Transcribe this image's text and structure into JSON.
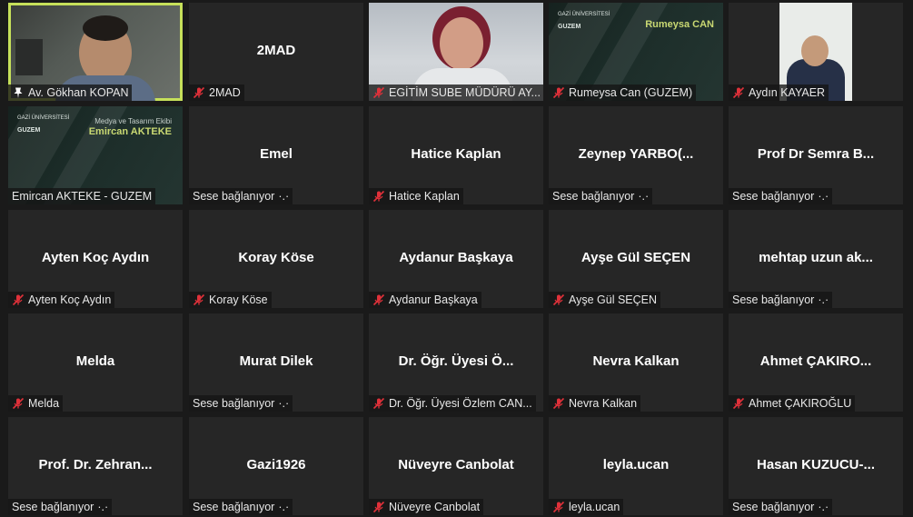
{
  "tiles": [
    {
      "id": "gokhan",
      "center": "",
      "label": "Av. Gökhan KOPAN",
      "icon": "pin",
      "connecting": false,
      "video": "gokhan",
      "active": true
    },
    {
      "id": "2mad",
      "center": "2MAD",
      "label": "2MAD",
      "icon": "mic-muted",
      "connecting": false
    },
    {
      "id": "egitim",
      "center": "",
      "label": "EGİTİM SUBE MÜDÜRÜ AY...",
      "icon": "mic-muted",
      "connecting": false,
      "video": "egitim"
    },
    {
      "id": "rumeysa",
      "center": "",
      "label": "Rumeysa Can (GUZEM)",
      "icon": "mic-muted",
      "connecting": false,
      "video": "rumeysa"
    },
    {
      "id": "aydin",
      "center": "",
      "label": "Aydın KAYAER",
      "icon": "mic-muted",
      "connecting": false,
      "video": "aydin"
    },
    {
      "id": "emircan",
      "center": "",
      "label": "Emircan AKTEKE - GUZEM",
      "icon": "none",
      "connecting": false,
      "video": "emircan"
    },
    {
      "id": "emel",
      "center": "Emel",
      "label": "Sese bağlanıyor",
      "icon": "none",
      "connecting": true
    },
    {
      "id": "hatice",
      "center": "Hatice Kaplan",
      "label": "Hatice Kaplan",
      "icon": "mic-muted",
      "connecting": false
    },
    {
      "id": "zeynep",
      "center": "Zeynep YARBO(...",
      "label": "Sese bağlanıyor",
      "icon": "none",
      "connecting": true
    },
    {
      "id": "semra",
      "center": "Prof Dr Semra B...",
      "label": "Sese bağlanıyor",
      "icon": "none",
      "connecting": true
    },
    {
      "id": "ayten",
      "center": "Ayten Koç Aydın",
      "label": "Ayten Koç Aydın",
      "icon": "mic-muted",
      "connecting": false
    },
    {
      "id": "koray",
      "center": "Koray Köse",
      "label": "Koray Köse",
      "icon": "mic-muted",
      "connecting": false
    },
    {
      "id": "aydanur",
      "center": "Aydanur Başkaya",
      "label": "Aydanur Başkaya",
      "icon": "mic-muted",
      "connecting": false
    },
    {
      "id": "aysegul",
      "center": "Ayşe Gül SEÇEN",
      "label": "Ayşe Gül SEÇEN",
      "icon": "mic-muted",
      "connecting": false
    },
    {
      "id": "mehtap",
      "center": "mehtap uzun ak...",
      "label": "Sese bağlanıyor",
      "icon": "none",
      "connecting": true
    },
    {
      "id": "melda",
      "center": "Melda",
      "label": "Melda",
      "icon": "mic-muted",
      "connecting": false
    },
    {
      "id": "murat",
      "center": "Murat Dilek",
      "label": "Sese bağlanıyor",
      "icon": "none",
      "connecting": true
    },
    {
      "id": "ozlem",
      "center": "Dr. Öğr. Üyesi Ö...",
      "label": "Dr. Öğr. Üyesi Özlem CAN...",
      "icon": "mic-muted",
      "connecting": false
    },
    {
      "id": "nevra",
      "center": "Nevra Kalkan",
      "label": "Nevra Kalkan",
      "icon": "mic-muted",
      "connecting": false
    },
    {
      "id": "ahmet",
      "center": "Ahmet ÇAKIRO...",
      "label": "Ahmet ÇAKIROĞLU",
      "icon": "mic-muted",
      "connecting": false
    },
    {
      "id": "zehran",
      "center": "Prof. Dr. Zehran...",
      "label": "Sese bağlanıyor",
      "icon": "none",
      "connecting": true
    },
    {
      "id": "gazi",
      "center": "Gazi1926",
      "label": "Sese bağlanıyor",
      "icon": "none",
      "connecting": true
    },
    {
      "id": "nuveyre",
      "center": "Nüveyre Canbolat",
      "label": "Nüveyre Canbolat",
      "icon": "mic-muted",
      "connecting": false
    },
    {
      "id": "leyla",
      "center": "leyla.ucan",
      "label": "leyla.ucan",
      "icon": "mic-muted",
      "connecting": false
    },
    {
      "id": "hasan",
      "center": "Hasan KUZUCU-...",
      "label": "Sese bağlanıyor",
      "icon": "none",
      "connecting": true
    }
  ],
  "guzem": {
    "logo_line1": "GAZİ ÜNİVERSİTESİ",
    "logo_line2": "GUZEM",
    "rumeysa_title": "Rumeysa CAN",
    "emircan_sub": "Medya ve Tasarım Ekibi",
    "emircan_title": "Emircan AKTEKE"
  },
  "connecting_dots": "·.·",
  "colors": {
    "active_border": "#c6e05a",
    "mute_red": "#e0313a",
    "tile_bg": "#262626"
  }
}
